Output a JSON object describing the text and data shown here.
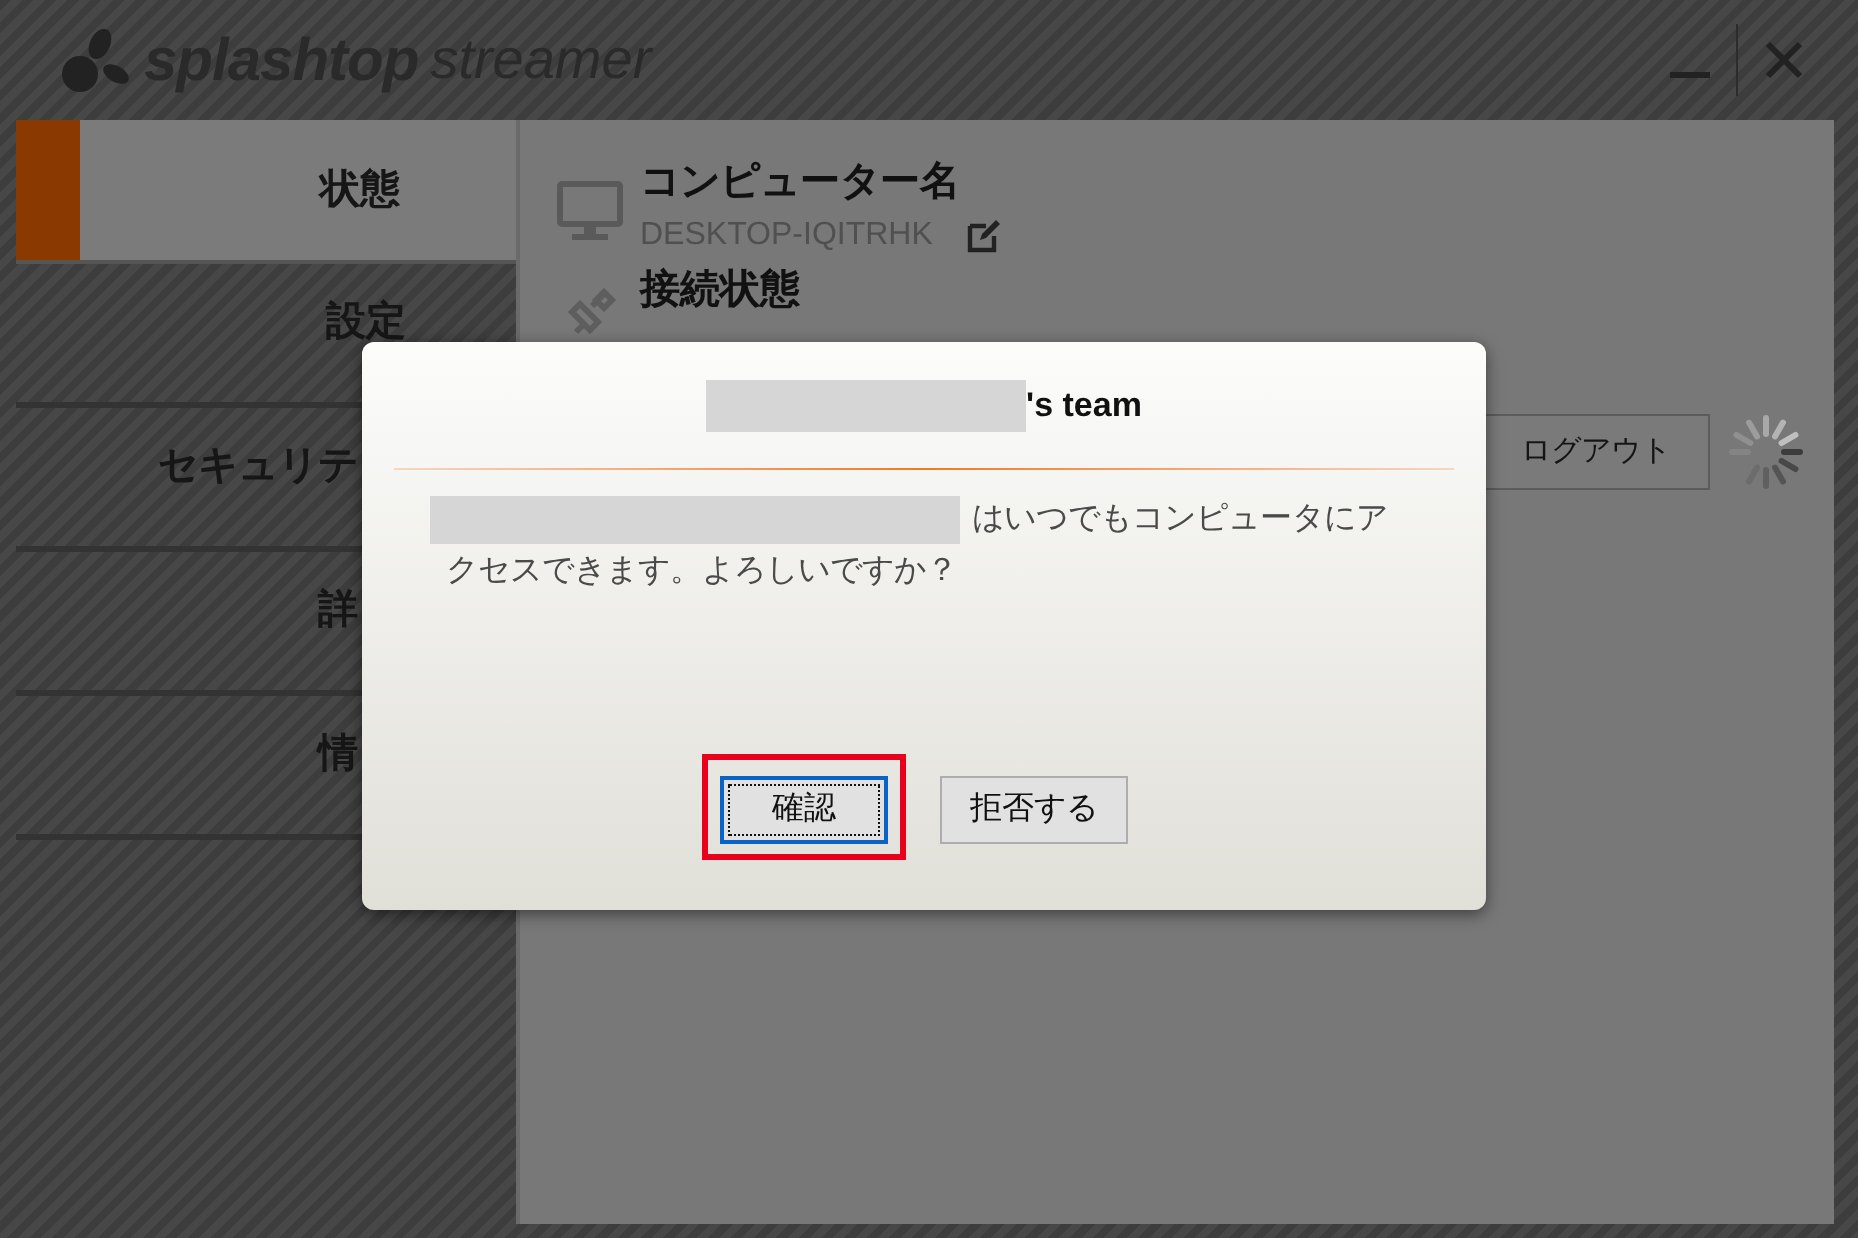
{
  "logo": {
    "brand": "splashtop",
    "product": "streamer"
  },
  "window_controls": [
    {
      "kind": "minimize"
    },
    {
      "kind": "close"
    }
  ],
  "sidebar": {
    "items": [
      {
        "label": "状態",
        "selected": true
      },
      {
        "label": "設定",
        "selected": false
      },
      {
        "label": "セキュリテ",
        "selected": false
      },
      {
        "label": "詳",
        "selected": false
      },
      {
        "label": "情",
        "selected": false
      }
    ]
  },
  "status": {
    "computer_name_label": "コンピューター名",
    "computer_name": "DESKTOP-IQITRHK",
    "connection_label": "接続状態",
    "logout_button": "ログアウト"
  },
  "dialog": {
    "title_suffix": "'s team",
    "message_lines": [
      "はいつでもコンピュータにア",
      "クセスできます。よろしいですか？"
    ],
    "buttons": [
      {
        "label": "確認",
        "focused": true,
        "highlighted": true
      },
      {
        "label": "拒否する",
        "focused": false,
        "highlighted": false
      }
    ]
  }
}
